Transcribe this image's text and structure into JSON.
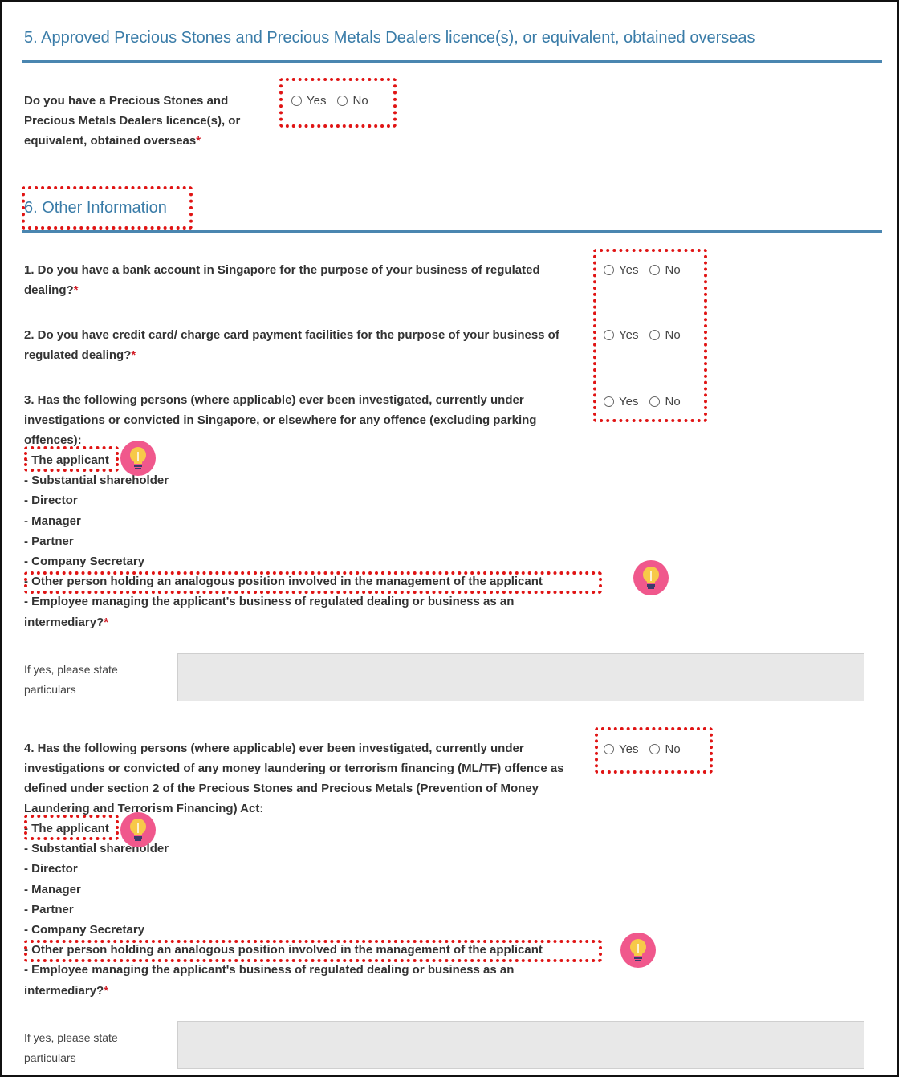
{
  "section5": {
    "title": "5. Approved Precious Stones and Precious Metals Dealers licence(s), or equivalent, obtained overseas",
    "question": {
      "text": "Do you have a Precious Stones and Precious Metals Dealers licence(s), or equivalent, obtained overseas",
      "required": "*",
      "yes": "Yes",
      "no": "No"
    }
  },
  "section6": {
    "title": "6. Other Information",
    "q1": {
      "text": "1. Do you have a bank account in Singapore for the purpose of your business of regulated dealing?",
      "required": "*",
      "yes": "Yes",
      "no": "No"
    },
    "q2": {
      "text": "2. Do you have credit card/ charge card payment facilities for the purpose of your business of regulated dealing?",
      "required": "*",
      "yes": "Yes",
      "no": "No"
    },
    "q3": {
      "text": "3. Has the following persons (where applicable) ever been investigated, currently under investigations or convicted in Singapore, or elsewhere for any offence (excluding parking offences):",
      "persons": [
        "- The applicant",
        "- Substantial shareholder",
        "- Director",
        "- Manager",
        "- Partner",
        "- Company Secretary",
        "- Other person holding an analogous position involved in the management of the applicant",
        "- Employee managing the applicant's business of regulated dealing or business as an"
      ],
      "last_line": "intermediary?",
      "required": "*",
      "yes": "Yes",
      "no": "No",
      "particulars_label": "If yes, please state particulars",
      "particulars_value": ""
    },
    "q4": {
      "text": "4. Has the following persons (where applicable) ever been investigated, currently under investigations or convicted of any money laundering or terrorism financing (ML/TF) offence as defined under section 2 of the Precious Stones and Precious Metals (Prevention of Money Laundering and Terrorism Financing) Act:",
      "persons": [
        "- The applicant",
        "- Substantial shareholder",
        "- Director",
        "- Manager",
        "- Partner",
        "- Company Secretary",
        "- Other person holding an analogous position involved in the management of the applicant",
        "- Employee managing the applicant's business of regulated dealing or business as an"
      ],
      "last_line": "intermediary?",
      "required": "*",
      "yes": "Yes",
      "no": "No",
      "particulars_label": "If yes, please state particulars",
      "particulars_value": ""
    }
  },
  "icons": {
    "tip": "lightbulb-icon"
  },
  "colors": {
    "section_title": "#3a7ca8",
    "rule": "#4a86b0",
    "required": "#d2202a",
    "highlight": "#e01414",
    "bulb_bg": "#f0588c",
    "bulb": "#f7c948"
  }
}
